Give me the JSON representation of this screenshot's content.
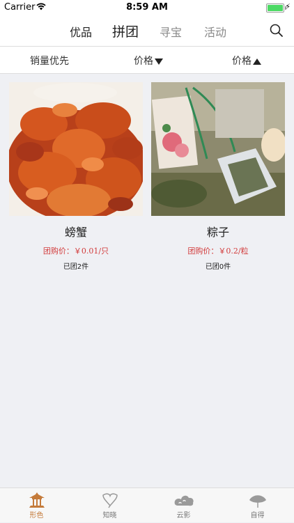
{
  "status_bar": {
    "carrier": "Carrier",
    "time": "8:59 AM"
  },
  "top_tabs": [
    {
      "label": "优品"
    },
    {
      "label": "拼团"
    },
    {
      "label": "寻宝"
    },
    {
      "label": "活动"
    }
  ],
  "filters": {
    "sales_first": "销量优先",
    "price_desc": "价格",
    "price_asc": "价格"
  },
  "products": [
    {
      "name": "螃蟹",
      "price": "团购价：￥0.01/只",
      "sold": "已团2件"
    },
    {
      "name": "粽子",
      "price": "团购价：￥0.2/粒",
      "sold": "已团0件"
    }
  ],
  "bottom_tabs": [
    {
      "label": "形色"
    },
    {
      "label": "知晓"
    },
    {
      "label": "云影"
    },
    {
      "label": "自得"
    }
  ],
  "colors": {
    "accent": "#c47a3a",
    "price_red": "#d23a3a",
    "background": "#eff0f4"
  }
}
